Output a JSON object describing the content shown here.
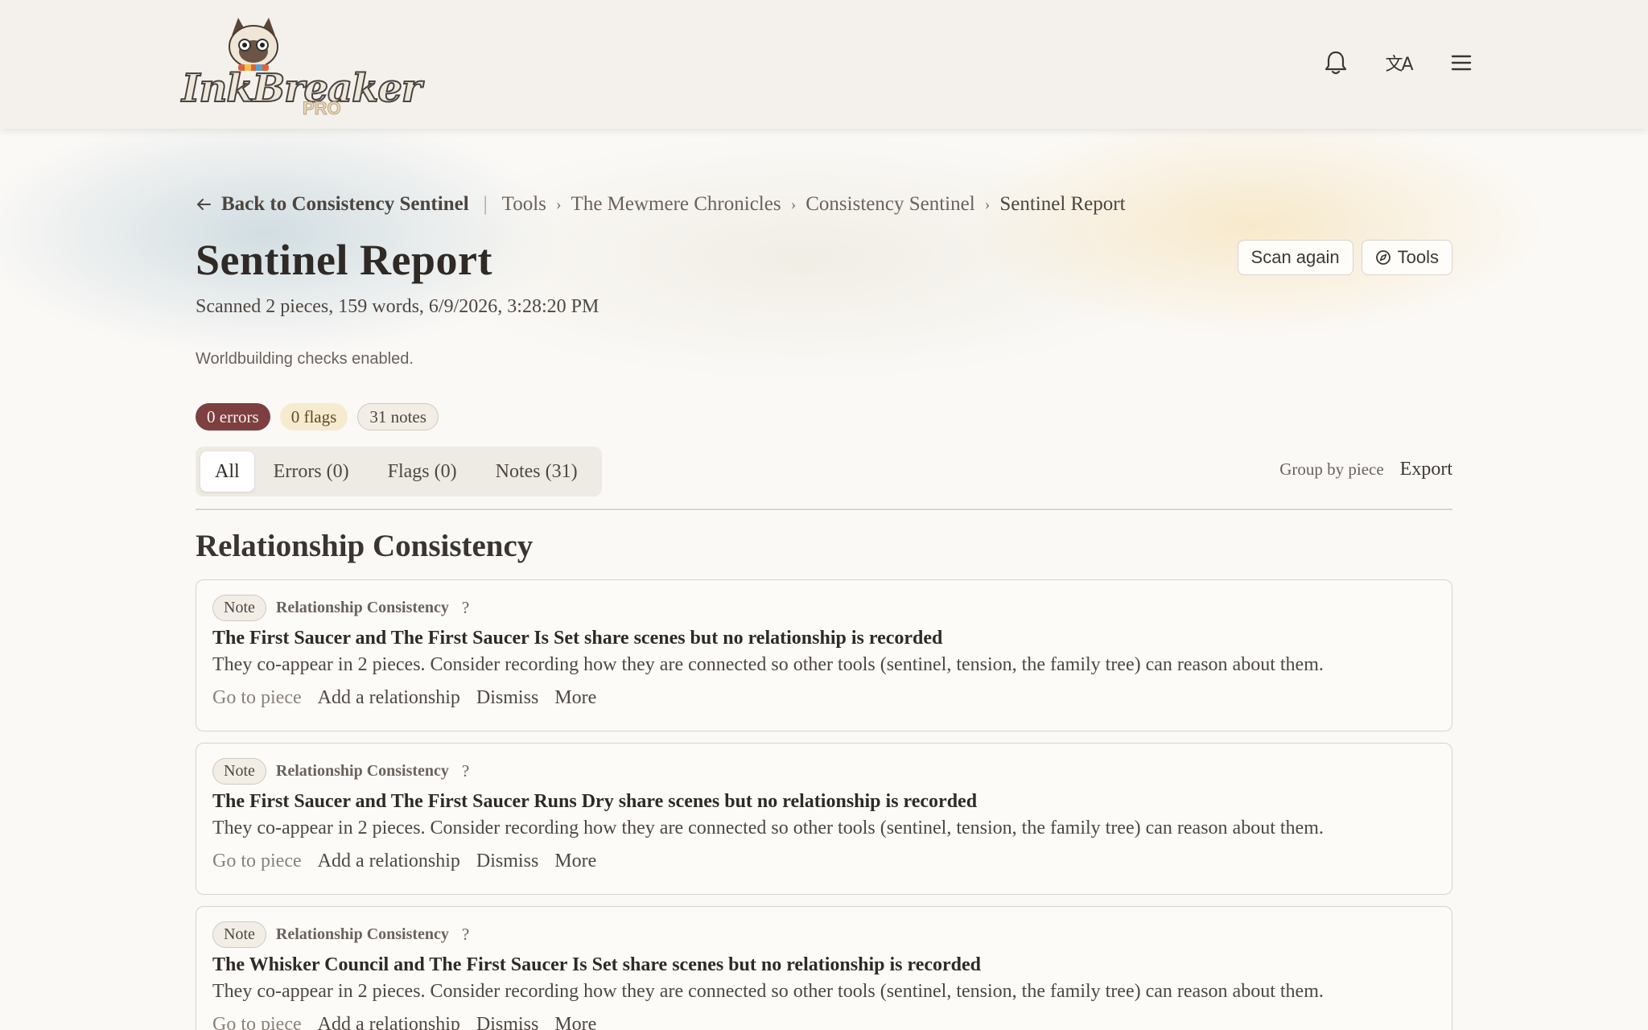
{
  "app": {
    "logo_text": "InkBreaker",
    "logo_badge": "PRO"
  },
  "header": {
    "icons": [
      "bell-icon",
      "translate-icon",
      "menu-icon"
    ],
    "translate_glyph": "文A"
  },
  "breadcrumb": {
    "back_label": "Back to Consistency Sentinel",
    "items": [
      "Tools",
      "The Mewmere Chronicles",
      "Consistency Sentinel"
    ],
    "current": "Sentinel Report"
  },
  "page": {
    "title": "Sentinel Report",
    "scan_meta": "Scanned 2 pieces, 159 words, 6/9/2026, 3:28:20 PM",
    "worldbuilding_note": "Worldbuilding checks enabled.",
    "actions": {
      "scan_again": "Scan again",
      "tools": "Tools"
    }
  },
  "counts": {
    "errors": "0 errors",
    "flags": "0 flags",
    "notes": "31 notes"
  },
  "tabs": [
    {
      "label": "All",
      "active": true
    },
    {
      "label": "Errors (0)",
      "active": false
    },
    {
      "label": "Flags (0)",
      "active": false
    },
    {
      "label": "Notes (31)",
      "active": false
    }
  ],
  "list_tools": {
    "group_by": "Group by piece",
    "export": "Export"
  },
  "section": {
    "title": "Relationship Consistency"
  },
  "cards": [
    {
      "badge": "Note",
      "category": "Relationship Consistency",
      "help": "?",
      "title": "The First Saucer and The First Saucer Is Set share scenes but no relationship is recorded",
      "description": "They co-appear in 2 pieces. Consider recording how they are connected so other tools (sentinel, tension, the family tree) can reason about them.",
      "actions": [
        "Go to piece",
        "Add a relationship",
        "Dismiss",
        "More"
      ]
    },
    {
      "badge": "Note",
      "category": "Relationship Consistency",
      "help": "?",
      "title": "The First Saucer and The First Saucer Runs Dry share scenes but no relationship is recorded",
      "description": "They co-appear in 2 pieces. Consider recording how they are connected so other tools (sentinel, tension, the family tree) can reason about them.",
      "actions": [
        "Go to piece",
        "Add a relationship",
        "Dismiss",
        "More"
      ]
    },
    {
      "badge": "Note",
      "category": "Relationship Consistency",
      "help": "?",
      "title": "The Whisker Council and The First Saucer Is Set share scenes but no relationship is recorded",
      "description": "They co-appear in 2 pieces. Consider recording how they are connected so other tools (sentinel, tension, the family tree) can reason about them.",
      "actions": [
        "Go to piece",
        "Add a relationship",
        "Dismiss",
        "More"
      ]
    }
  ],
  "colors": {
    "error_pill": "#7e3f40",
    "flag_pill": "#f7ebcf",
    "header_bg": "#f4f1ec",
    "text": "#2f2a26"
  }
}
